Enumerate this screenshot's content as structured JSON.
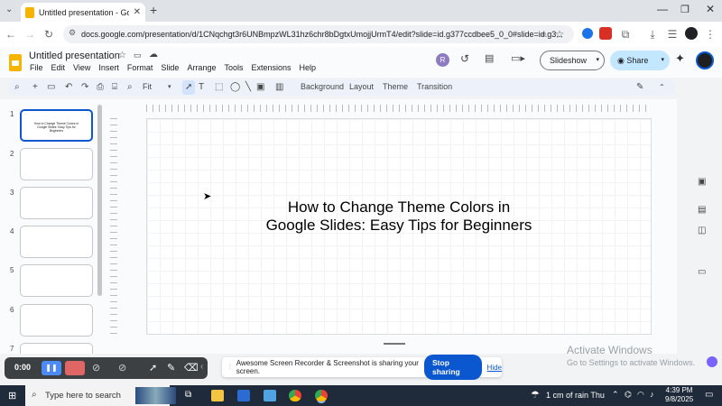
{
  "browser": {
    "tab_title": "Untitled presentation - Google...",
    "url": "docs.google.com/presentation/d/1CNqchgt3r6UNBmpzWL31hz6chr8bDgtxUmojjUrmT4/edit?slide=id.g377ccdbee5_0_0#slide=id.g3..."
  },
  "doc": {
    "title": "Untitled presentation",
    "menu": [
      "File",
      "Edit",
      "View",
      "Insert",
      "Format",
      "Slide",
      "Arrange",
      "Tools",
      "Extensions",
      "Help"
    ],
    "avatar_letter": "R",
    "slideshow_label": "Slideshow",
    "share_label": "Share"
  },
  "toolbar": {
    "zoom": "Fit",
    "background": "Background",
    "layout": "Layout",
    "theme": "Theme",
    "transition": "Transition"
  },
  "filmstrip": {
    "numbers": [
      "1",
      "2",
      "3",
      "4",
      "5",
      "6",
      "7"
    ],
    "thumb1_text": "How to Change Theme Colors in Google Slides: Easy Tips for Beginners"
  },
  "slide": {
    "line1": "How to Change Theme Colors in",
    "line2": "Google Slides: Easy Tips for Beginners"
  },
  "recorder": {
    "time": "0:00"
  },
  "share_banner": {
    "message": "Awesome Screen Recorder & Screenshot is sharing your screen.",
    "stop_label": "Stop sharing",
    "hide_label": "Hide"
  },
  "watermark": {
    "title": "Activate Windows",
    "subtitle": "Go to Settings to activate Windows."
  },
  "taskbar": {
    "search_placeholder": "Type here to search",
    "weather": "1 cm of rain Thu",
    "time": "4:39 PM",
    "date": "9/8/2025"
  }
}
